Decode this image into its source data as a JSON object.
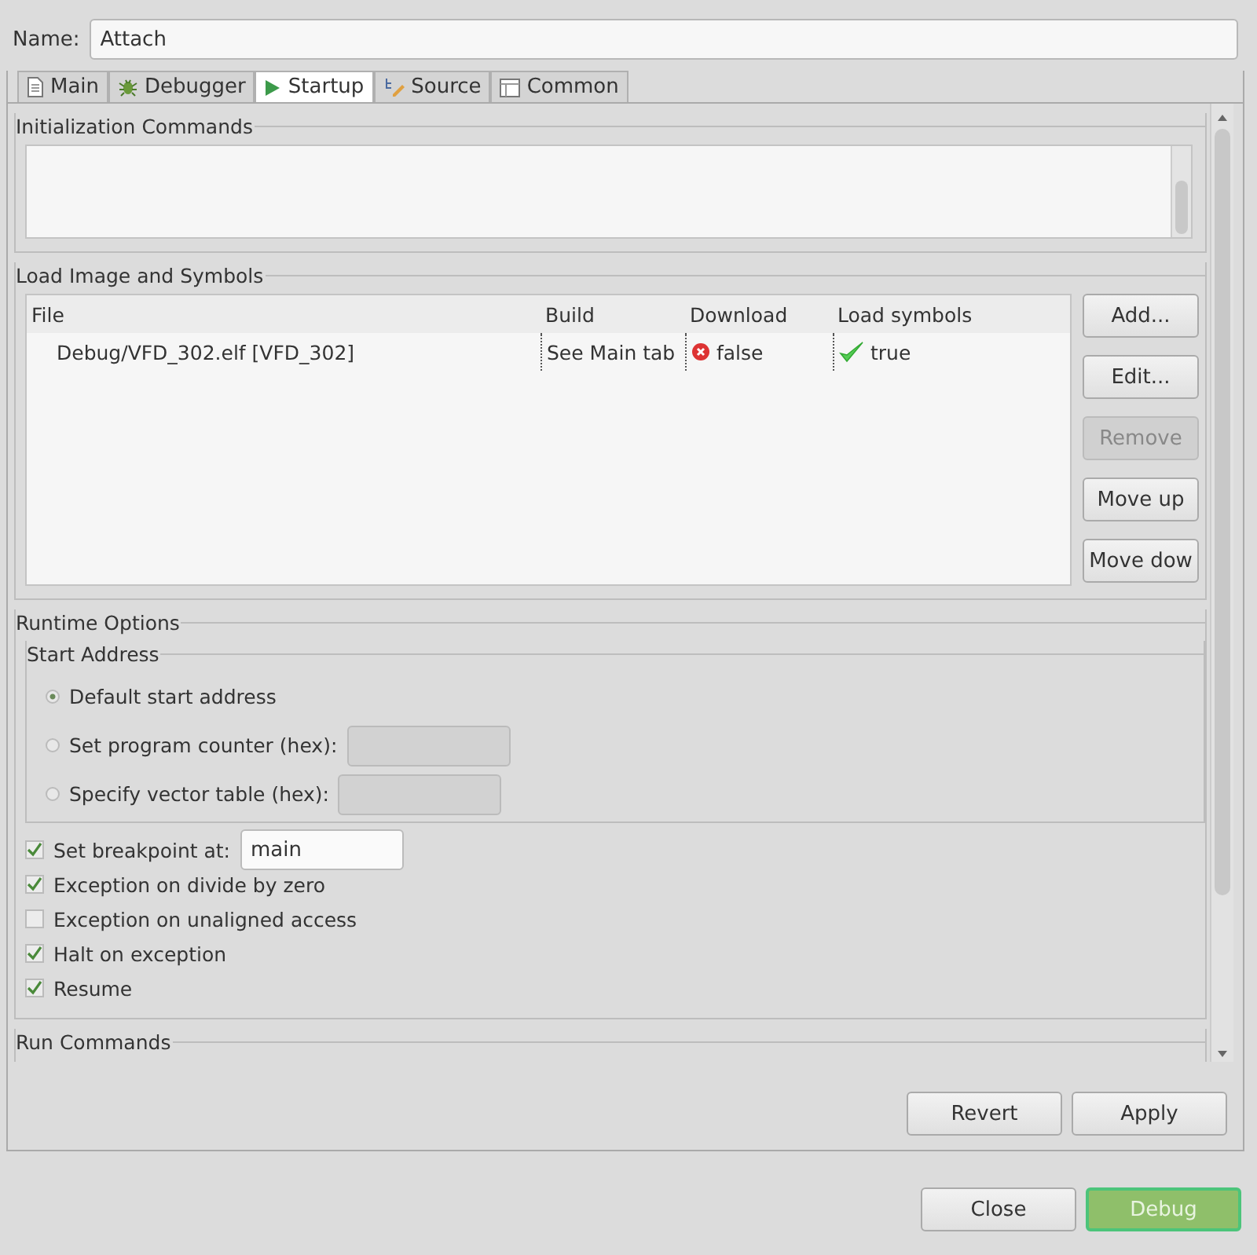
{
  "name": {
    "label": "Name:",
    "value": "Attach"
  },
  "tabs": [
    {
      "label": "Main",
      "selected": false
    },
    {
      "label": "Debugger",
      "selected": false
    },
    {
      "label": "Startup",
      "selected": true
    },
    {
      "label": "Source",
      "selected": false
    },
    {
      "label": "Common",
      "selected": false
    }
  ],
  "init_commands": {
    "title": "Initialization Commands"
  },
  "load_image": {
    "title": "Load Image and Symbols",
    "table": {
      "columns": [
        "File",
        "Build",
        "Download",
        "Load symbols"
      ],
      "rows": [
        {
          "file": "Debug/VFD_302.elf [VFD_302]",
          "build": "See Main tab",
          "download": {
            "text": "false",
            "kind": "error"
          },
          "load_symbols": {
            "text": "true",
            "kind": "ok"
          }
        }
      ]
    },
    "buttons": [
      {
        "label": "Add...",
        "disabled": false
      },
      {
        "label": "Edit...",
        "disabled": false
      },
      {
        "label": "Remove",
        "disabled": true
      },
      {
        "label": "Move up",
        "disabled": false
      },
      {
        "label": "Move dow",
        "disabled": false
      }
    ]
  },
  "runtime": {
    "title": "Runtime Options",
    "start_address": {
      "title": "Start Address",
      "options": [
        {
          "label": "Default start address",
          "selected": true
        },
        {
          "label": "Set program counter (hex):",
          "selected": false,
          "field": {
            "disabled": true
          }
        },
        {
          "label": "Specify vector table (hex):",
          "selected": false,
          "field": {
            "disabled": true
          }
        }
      ]
    },
    "options": [
      {
        "label": "Set breakpoint at:",
        "checked": true,
        "field": {
          "value": "main",
          "disabled": false
        }
      },
      {
        "label": "Exception on divide by zero",
        "checked": true
      },
      {
        "label": "Exception on unaligned access",
        "checked": false
      },
      {
        "label": "Halt on exception",
        "checked": true
      },
      {
        "label": "Resume",
        "checked": true
      }
    ]
  },
  "run_commands": {
    "title": "Run Commands"
  },
  "panel_buttons": [
    {
      "label": "Revert",
      "default": false
    },
    {
      "label": "Apply",
      "default": false
    }
  ],
  "dialog_buttons": [
    {
      "label": "Close",
      "default": false
    },
    {
      "label": "Debug",
      "default": true
    }
  ]
}
